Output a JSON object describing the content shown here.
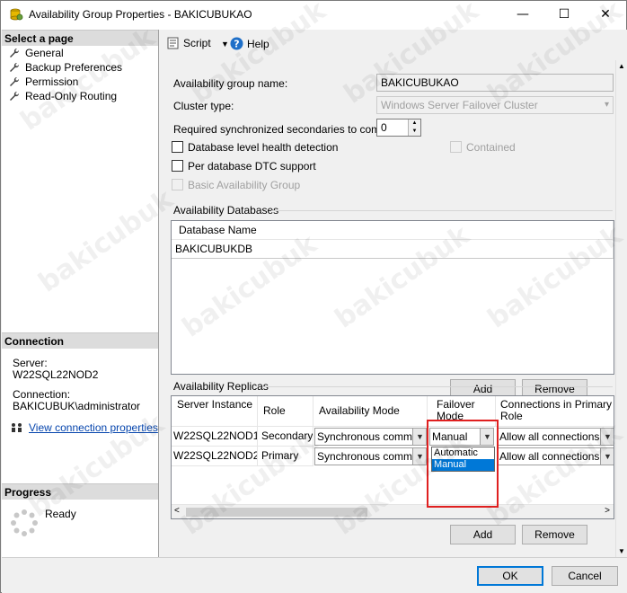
{
  "window": {
    "title": "Availability Group Properties - BAKICUBUKAO",
    "minimize_glyph": "—",
    "maximize_glyph": "☐",
    "close_glyph": "✕"
  },
  "left": {
    "select_page_header": "Select a page",
    "pages": [
      "General",
      "Backup Preferences",
      "Permission",
      "Read-Only Routing"
    ],
    "connection_header": "Connection",
    "server_label": "Server:",
    "server_value": "W22SQL22NOD2",
    "connection_label": "Connection:",
    "connection_value": "BAKICUBUK\\administrator",
    "view_connection_link": "View connection properties",
    "progress_header": "Progress",
    "progress_status": "Ready"
  },
  "toolbar": {
    "script_label": "Script",
    "help_label": "Help"
  },
  "general": {
    "ag_name_label": "Availability group name:",
    "ag_name_value": "BAKICUBUKAO",
    "cluster_type_label": "Cluster type:",
    "cluster_type_value": "Windows Server Failover Cluster",
    "req_sync_label": "Required synchronized secondaries to commit:",
    "req_sync_value": "0",
    "db_health_label": "Database level health detection",
    "contained_label": "Contained",
    "per_db_dtc_label": "Per database DTC support",
    "basic_ag_label": "Basic Availability Group"
  },
  "databases": {
    "section_label": "Availability Databases",
    "column_header": "Database Name",
    "rows": [
      "BAKICUBUKDB"
    ],
    "add_label": "Add",
    "remove_label": "Remove"
  },
  "replicas": {
    "section_label": "Availability Replicas",
    "headers": {
      "server_instance": "Server Instance",
      "role": "Role",
      "availability_mode": "Availability Mode",
      "failover_mode": "Failover Mode",
      "connections_primary": "Connections in Primary Role"
    },
    "rows": [
      {
        "server": "W22SQL22NOD1",
        "role": "Secondary",
        "mode": "Synchronous commit",
        "failover": "Manual",
        "connections": "Allow all connections"
      },
      {
        "server": "W22SQL22NOD2",
        "role": "Primary",
        "mode": "Synchronous commit",
        "failover": "Manual",
        "connections": "Allow all connections"
      }
    ],
    "failover_options": [
      "Automatic",
      "Manual"
    ],
    "failover_selected": "Manual",
    "add_label": "Add",
    "remove_label": "Remove"
  },
  "footer": {
    "ok_label": "OK",
    "cancel_label": "Cancel"
  },
  "watermark_text": "bakicubuk",
  "colors": {
    "accent": "#0078d7",
    "highlight_border": "#e02020",
    "link": "#0645ad"
  }
}
